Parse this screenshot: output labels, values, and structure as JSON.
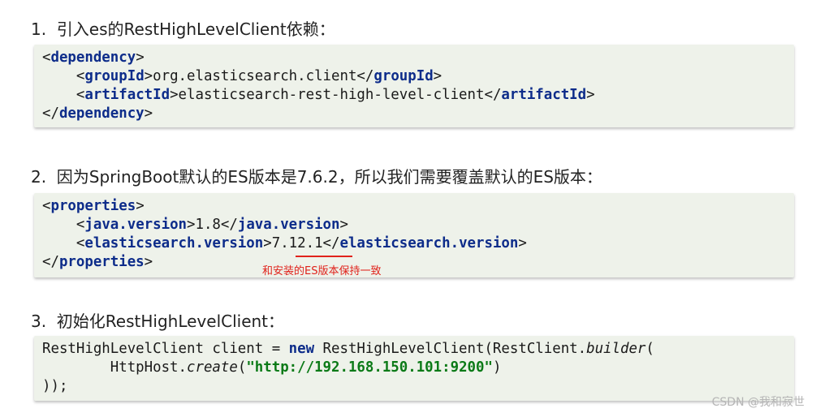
{
  "steps": [
    {
      "heading": "1.  引入es的RestHighLevelClient依赖：",
      "lines": [
        {
          "indent": "",
          "open": "<",
          "tag": "dependency",
          "close": ">"
        },
        {
          "indent": "    ",
          "open": "<",
          "tag": "groupId",
          "mid": ">org.elasticsearch.client</",
          "tag2": "groupId",
          "close": ">"
        },
        {
          "indent": "    ",
          "open": "<",
          "tag": "artifactId",
          "mid": ">elasticsearch-rest-high-level-client</",
          "tag2": "artifactId",
          "close": ">"
        },
        {
          "indent": "",
          "open": "</",
          "tag": "dependency",
          "close": ">"
        }
      ]
    },
    {
      "heading": "2.  因为SpringBoot默认的ES版本是7.6.2，所以我们需要覆盖默认的ES版本：",
      "lines": [
        {
          "indent": "",
          "open": "<",
          "tag": "properties",
          "close": ">"
        },
        {
          "indent": "    ",
          "open": "<",
          "tag": "java.version",
          "mid": ">1.8</",
          "tag2": "java.version",
          "close": ">"
        },
        {
          "indent": "    ",
          "open": "<",
          "tag": "elasticsearch.version",
          "mid": ">7.12.1</",
          "tag2": "elasticsearch.version",
          "close": ">"
        },
        {
          "indent": "",
          "open": "</",
          "tag": "properties",
          "close": ">"
        }
      ],
      "annotation": "和安装的ES版本保持一致"
    },
    {
      "heading": "3.  初始化RestHighLevelClient：",
      "code": {
        "l1_a": "RestHighLevelClient client = ",
        "l1_kw": "new",
        "l1_b": " RestHighLevelClient(RestClient.",
        "l1_it": "builder",
        "l1_c": "(",
        "l2_a": "        HttpHost.",
        "l2_it": "create",
        "l2_b": "(",
        "l2_str": "\"http://192.168.150.101:9200\"",
        "l2_c": ")",
        "l3": "));"
      }
    }
  ],
  "watermark": "CSDN @我和寂世"
}
